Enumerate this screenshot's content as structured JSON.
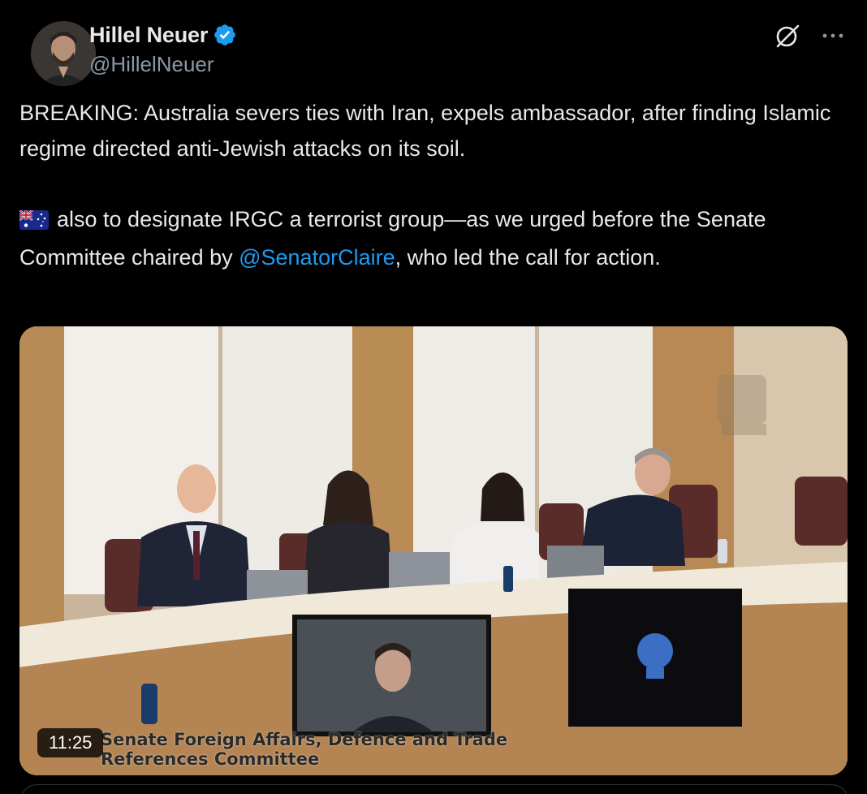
{
  "author": {
    "display_name": "Hillel Neuer",
    "handle": "@HillelNeuer",
    "verified": true,
    "verified_color": "#1d9bf0"
  },
  "header_icons": {
    "grok": "grok-icon",
    "more": "more-options-icon"
  },
  "post": {
    "paragraph1": "BREAKING: Australia severs ties with Iran, expels ambassador, after finding Islamic regime directed anti-Jewish attacks on its soil.",
    "flag_emoji": "australia-flag",
    "paragraph2_before_mention": "also to designate IRGC a terrorist group—as we urged before the Senate Committee chaired by ",
    "mention": "@SenatorClaire",
    "paragraph2_after_mention": ", who led the call for action.",
    "mention_color": "#1d9bf0"
  },
  "media": {
    "type": "video",
    "duration": "11:25",
    "caption_overlay": "Senate Foreign Affairs, Defence and Trade\nReferences Committee"
  }
}
